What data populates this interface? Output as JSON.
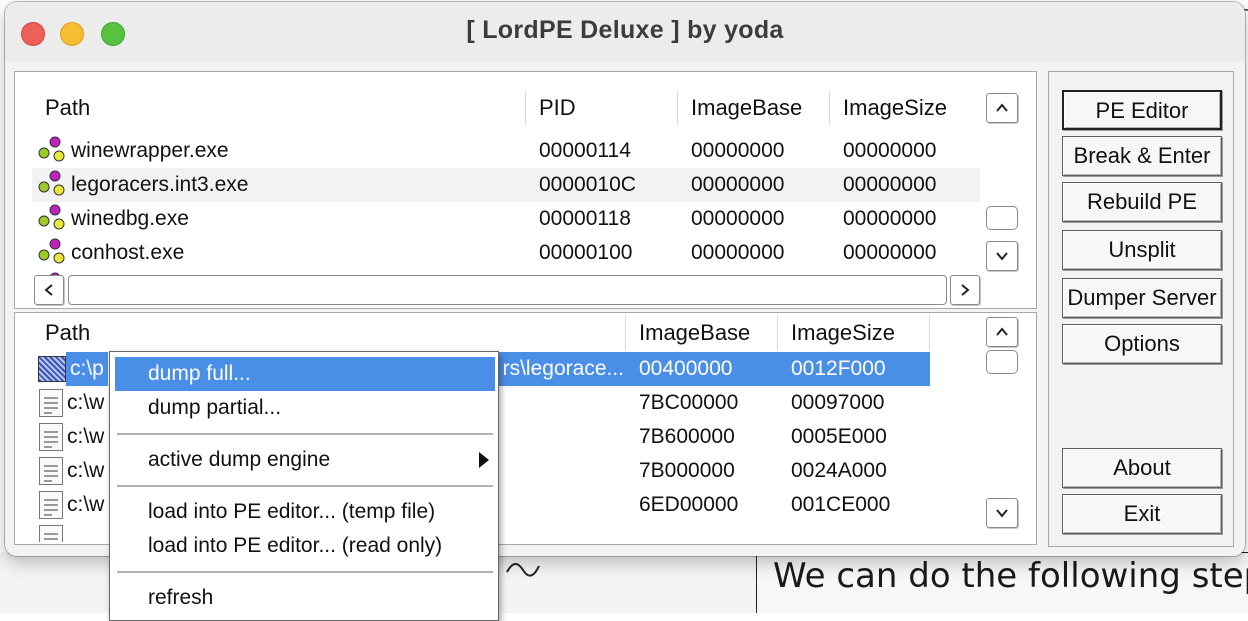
{
  "window": {
    "title": "[ LordPE Deluxe ] by yoda"
  },
  "process_list": {
    "columns": [
      "Path",
      "PID",
      "ImageBase",
      "ImageSize"
    ],
    "rows": [
      {
        "path": "winewrapper.exe",
        "pid": "00000114",
        "imagebase": "00000000",
        "imagesize": "00000000"
      },
      {
        "path": "legoracers.int3.exe",
        "pid": "0000010C",
        "imagebase": "00000000",
        "imagesize": "00000000"
      },
      {
        "path": "winedbg.exe",
        "pid": "00000118",
        "imagebase": "00000000",
        "imagesize": "00000000"
      },
      {
        "path": "conhost.exe",
        "pid": "00000100",
        "imagebase": "00000000",
        "imagesize": "00000000"
      }
    ]
  },
  "module_list": {
    "columns": [
      "Path",
      "ImageBase",
      "ImageSize"
    ],
    "rows": [
      {
        "path_start": "c:\\p",
        "path_end": "rs\\legorace...",
        "imagebase": "00400000",
        "imagesize": "0012F000"
      },
      {
        "path_start": "c:\\w",
        "path_end": "",
        "imagebase": "7BC00000",
        "imagesize": "00097000"
      },
      {
        "path_start": "c:\\w",
        "path_end": "",
        "imagebase": "7B600000",
        "imagesize": "0005E000"
      },
      {
        "path_start": "c:\\w",
        "path_end": "",
        "imagebase": "7B000000",
        "imagesize": "0024A000"
      },
      {
        "path_start": "c:\\w",
        "path_end": "",
        "imagebase": "6ED00000",
        "imagesize": "001CE000"
      }
    ]
  },
  "buttons": {
    "pe_editor": "PE Editor",
    "break_enter": "Break & Enter",
    "rebuild_pe": "Rebuild PE",
    "unsplit": "Unsplit",
    "dumper_server": "Dumper Server",
    "options": "Options",
    "about": "About",
    "exit": "Exit"
  },
  "context_menu": {
    "dump_full": "dump full...",
    "dump_partial": "dump partial...",
    "active_dump_engine": "active dump engine",
    "load_temp": "load into PE editor... (temp file)",
    "load_readonly": "load into PE editor... (read only)",
    "refresh": "refresh"
  },
  "background": {
    "caption": "We can do the following step"
  },
  "colors": {
    "selection": "#4a8fe7",
    "window_bg": "#ececec"
  }
}
